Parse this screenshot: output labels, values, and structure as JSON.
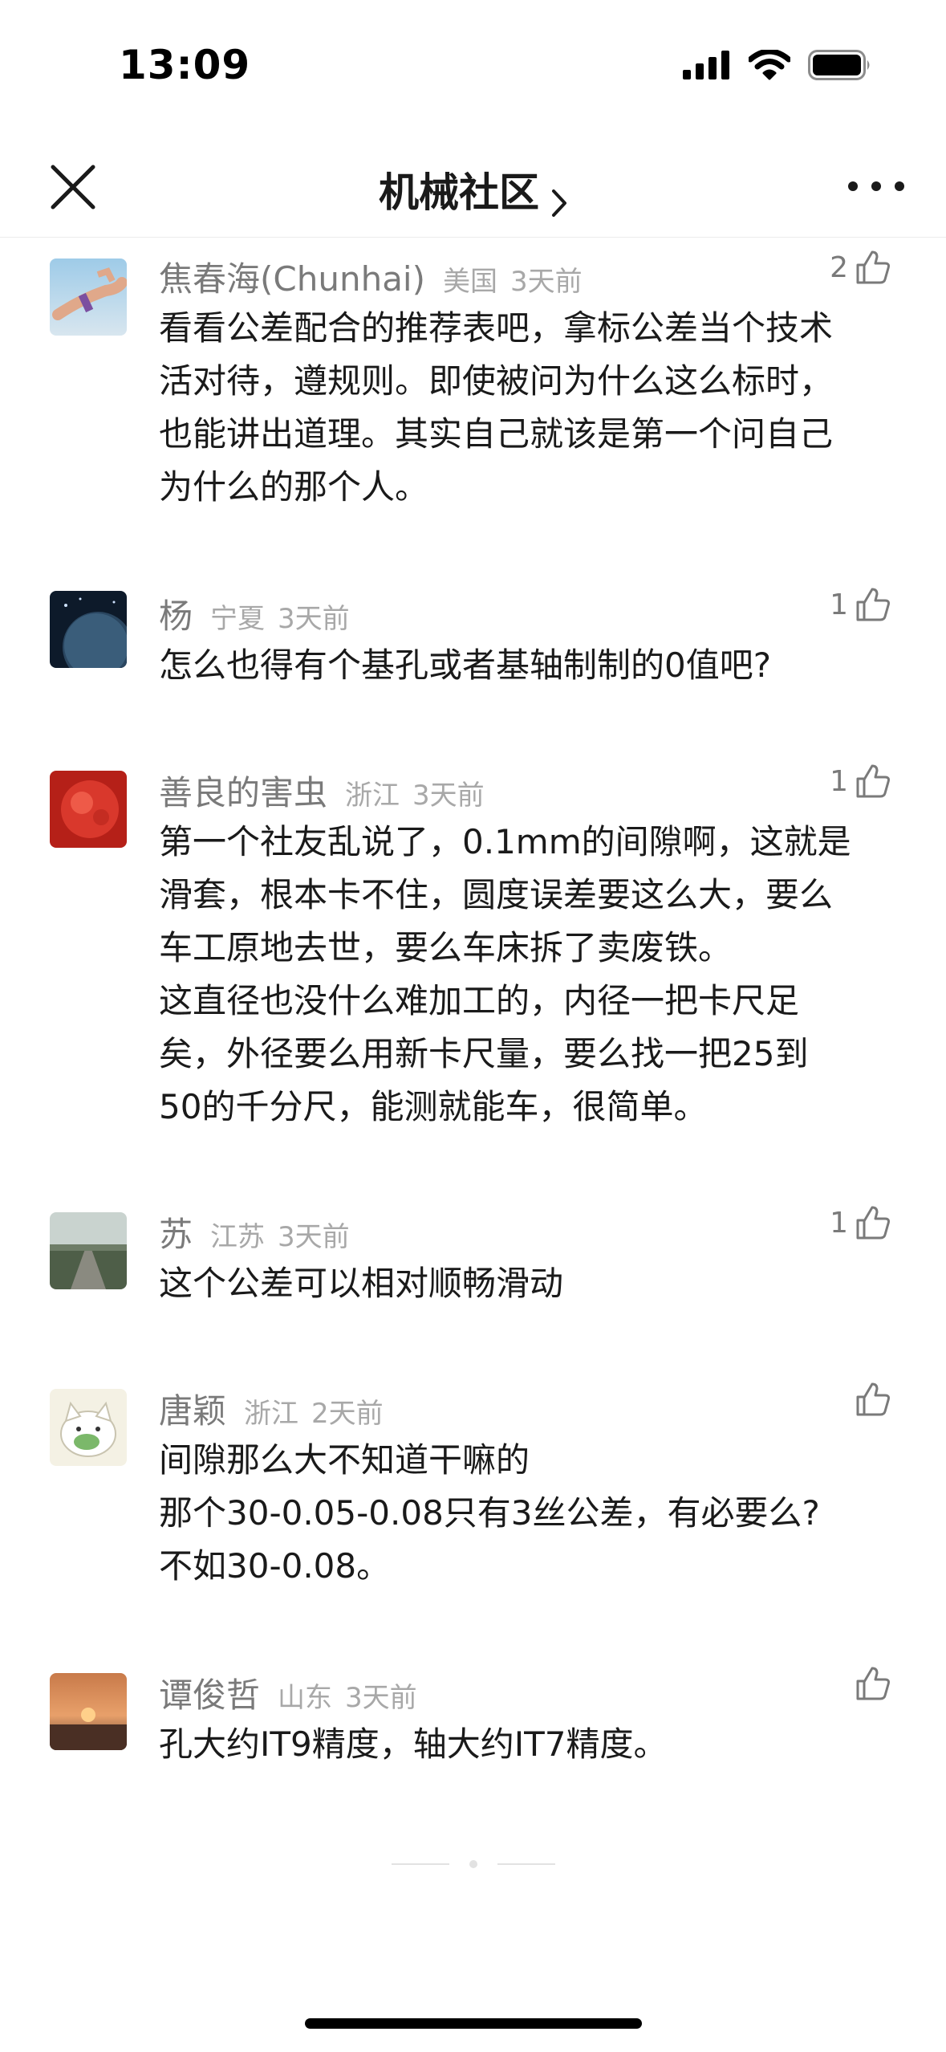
{
  "status_bar": {
    "time": "13:09"
  },
  "header": {
    "title": "机械社区"
  },
  "comments": [
    {
      "name": "焦春海(Chunhai)",
      "location": "美国",
      "time": "3天前",
      "likes": "2",
      "lines": [
        "看看公差配合的推荐表吧，拿标公差当个技术",
        "活对待，遵规则。即使被问为什么这么标时，",
        "也能讲出道理。其实自己就该是第一个问自己",
        "为什么的那个人。"
      ]
    },
    {
      "name": "杨",
      "location": "宁夏",
      "time": "3天前",
      "likes": "1",
      "lines": [
        "怎么也得有个基孔或者基轴制制的0值吧?"
      ]
    },
    {
      "name": "善良的害虫",
      "location": "浙江",
      "time": "3天前",
      "likes": "1",
      "lines": [
        "第一个社友乱说了，0.1mm的间隙啊，这就是",
        "滑套，根本卡不住，圆度误差要这么大，要么",
        "车工原地去世，要么车床拆了卖废铁。",
        "这直径也没什么难加工的，内径一把卡尺足",
        "矣，外径要么用新卡尺量，要么找一把25到",
        "50的千分尺，能测就能车，很简单。"
      ]
    },
    {
      "name": "苏",
      "location": "江苏",
      "time": "3天前",
      "likes": "1",
      "lines": [
        "这个公差可以相对顺畅滑动"
      ]
    },
    {
      "name": "唐颖",
      "location": "浙江",
      "time": "2天前",
      "likes": "",
      "lines": [
        "间隙那么大不知道干嘛的",
        "那个30-0.05-0.08只有3丝公差，有必要么?",
        "不如30-0.08。"
      ]
    },
    {
      "name": "谭俊哲",
      "location": "山东",
      "time": "3天前",
      "likes": "",
      "lines": [
        "孔大约IT9精度，轴大约IT7精度。"
      ]
    }
  ]
}
